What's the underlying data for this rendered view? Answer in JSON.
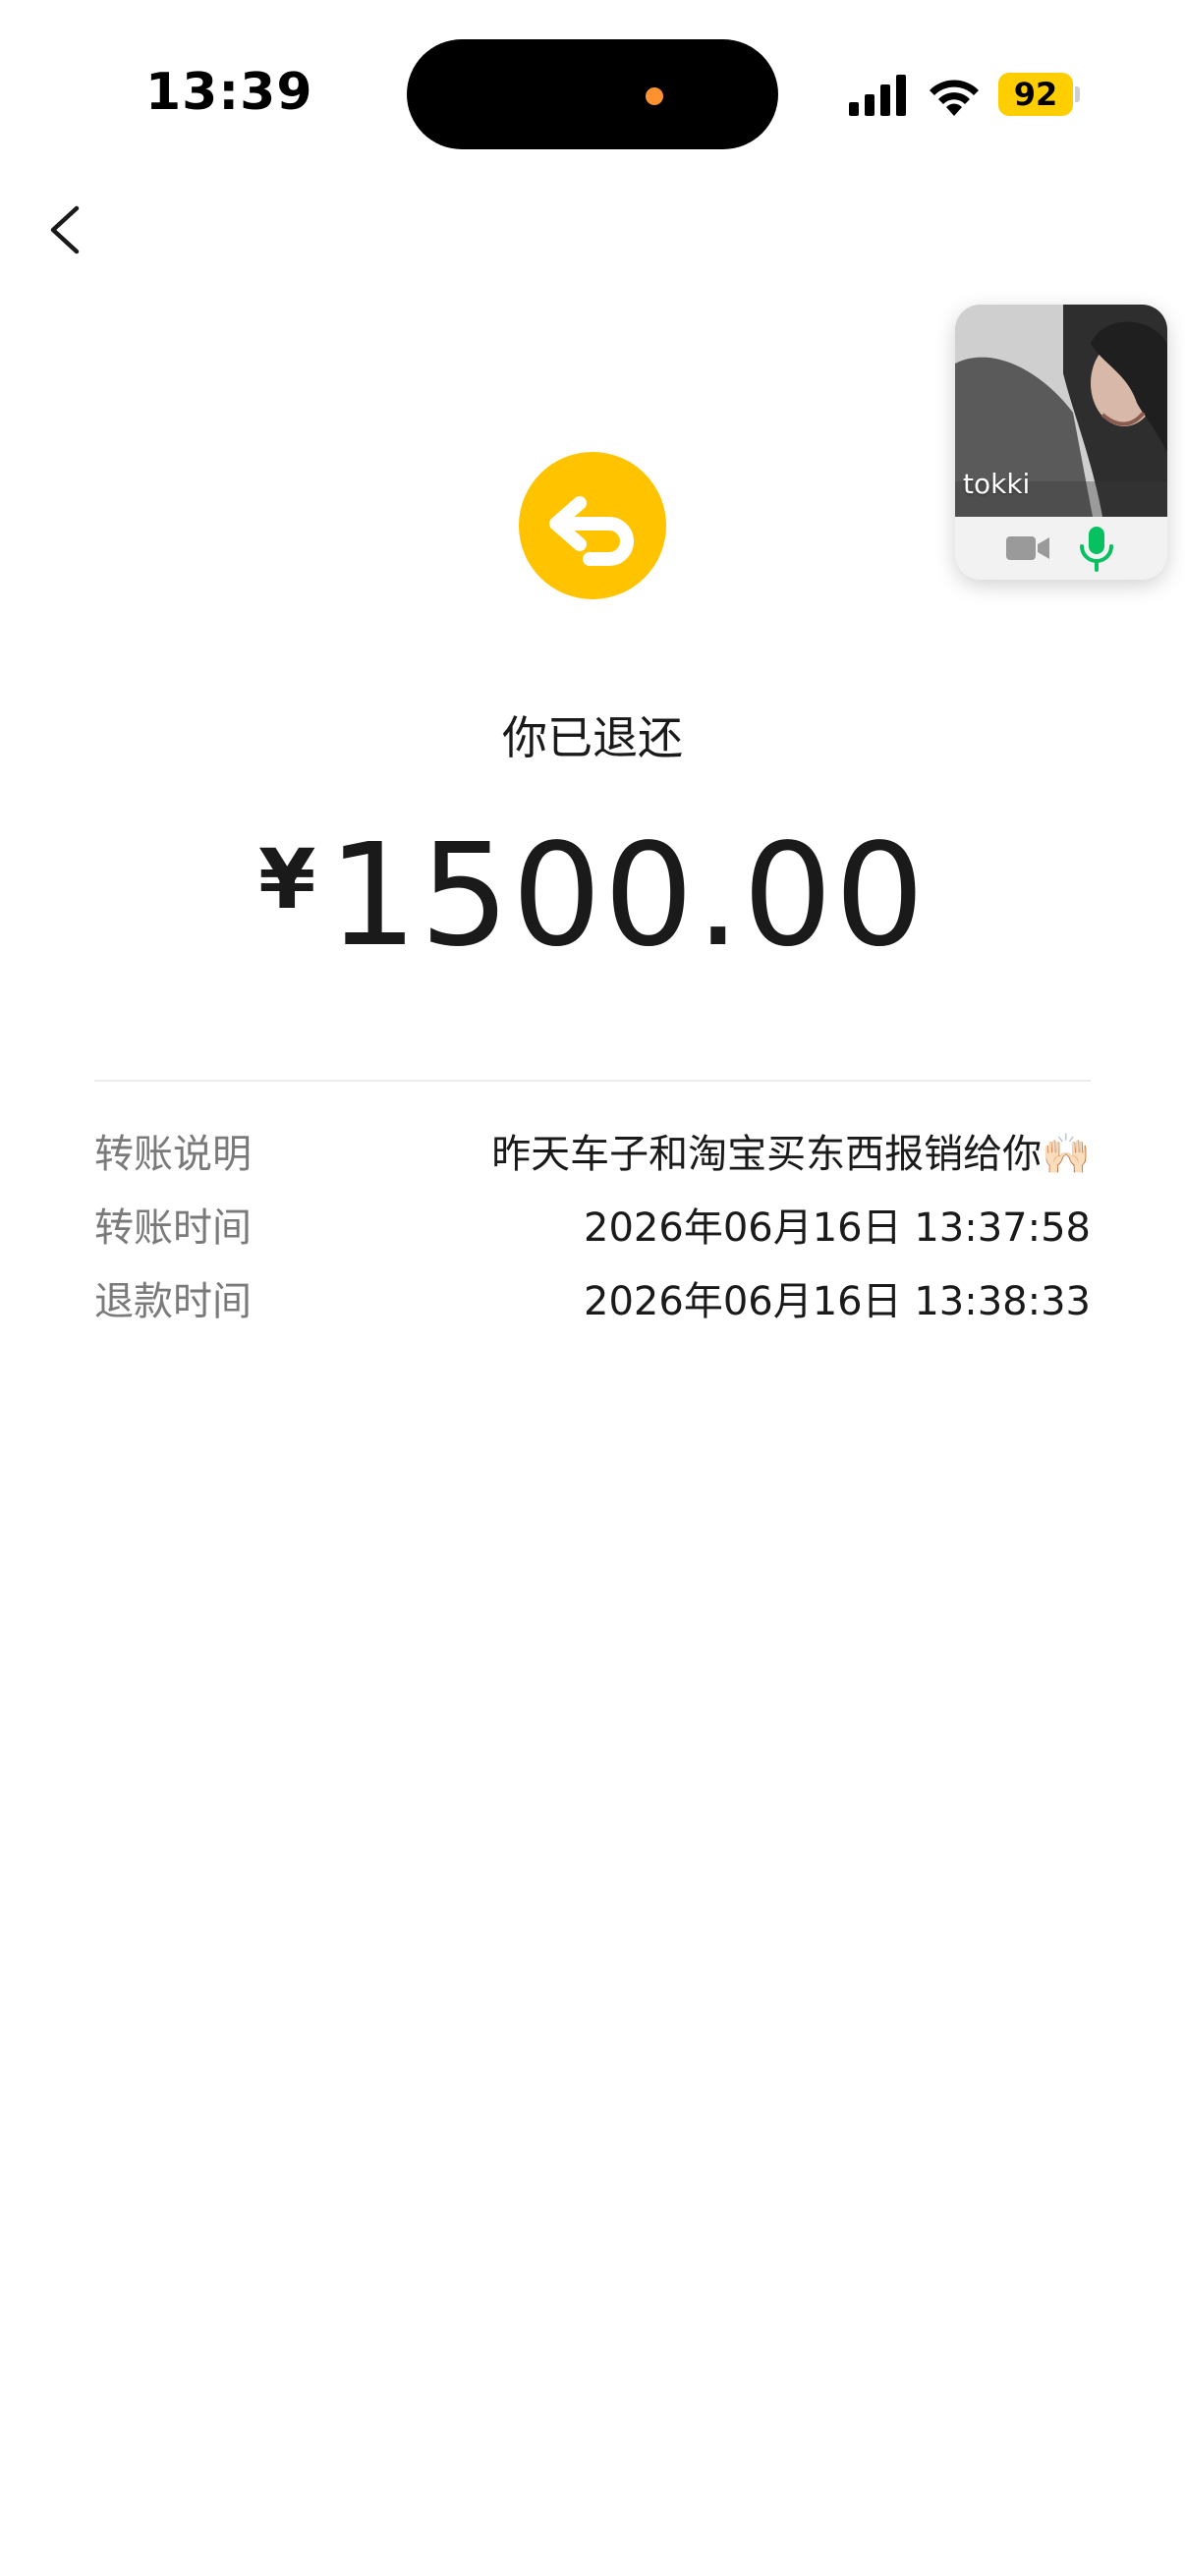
{
  "status_bar": {
    "time": "13:39",
    "battery_level": "92",
    "battery_color": "#ffce00"
  },
  "nav": {
    "back_icon": "chevron-left-icon"
  },
  "call_window": {
    "caller_name": "tokki",
    "camera_icon": "video-camera-icon",
    "mic_icon": "microphone-icon",
    "mic_color": "#07c160"
  },
  "transfer": {
    "status_icon": "refund-return-arrow-icon",
    "status_color": "#ffc300",
    "status_text": "你已退还",
    "currency_symbol": "¥",
    "amount": "1500.00"
  },
  "details": [
    {
      "label": "转账说明",
      "value": "昨天车子和淘宝买东西报销给你🙌🏻"
    },
    {
      "label": "转账时间",
      "value": "2026年06月16日 13:37:58"
    },
    {
      "label": "退款时间",
      "value": "2026年06月16日 13:38:33"
    }
  ]
}
